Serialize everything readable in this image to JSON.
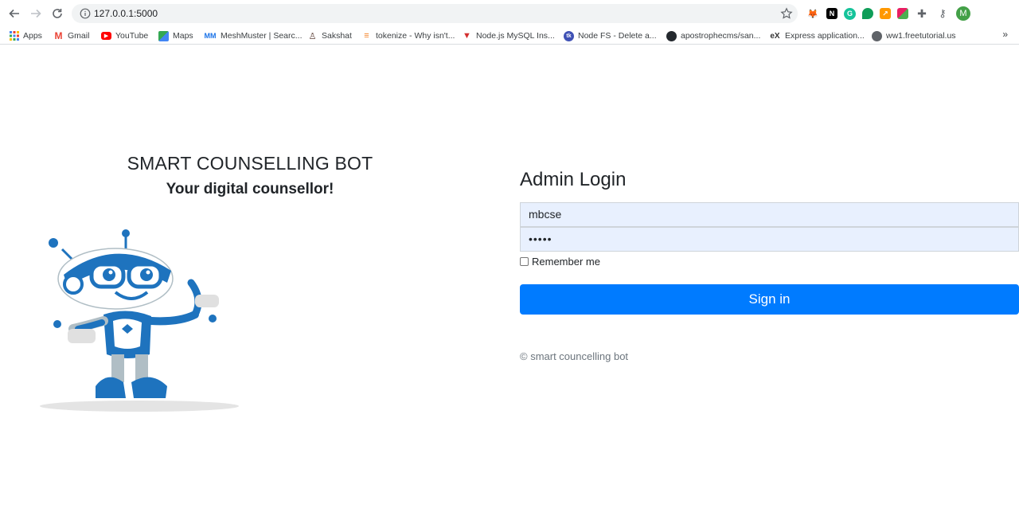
{
  "browser": {
    "url": "127.0.0.1:5000",
    "profile_initial": "M",
    "bookmarks": [
      {
        "label": "Apps",
        "icon": "apps-grid-icon"
      },
      {
        "label": "Gmail",
        "icon": "gmail-icon"
      },
      {
        "label": "YouTube",
        "icon": "youtube-icon"
      },
      {
        "label": "Maps",
        "icon": "maps-icon"
      },
      {
        "label": "MeshMuster | Searc...",
        "icon": "meshmuster-icon"
      },
      {
        "label": "Sakshat",
        "icon": "sakshat-icon"
      },
      {
        "label": "tokenize - Why isn't...",
        "icon": "tokenize-icon"
      },
      {
        "label": "Node.js MySQL Ins...",
        "icon": "node-mysql-icon"
      },
      {
        "label": "Node FS - Delete a...",
        "icon": "node-fs-icon"
      },
      {
        "label": "apostrophecms/san...",
        "icon": "github-icon"
      },
      {
        "label": "Express application...",
        "icon": "express-icon"
      },
      {
        "label": "ww1.freetutorial.us",
        "icon": "globe-icon"
      }
    ],
    "more": "»"
  },
  "brand": {
    "title": "SMART COUNSELLING BOT",
    "subtitle": "Your digital counsellor!"
  },
  "login": {
    "title": "Admin Login",
    "username_value": "mbcse",
    "password_value": "•••••",
    "remember_label": "Remember me",
    "signin_label": "Sign in",
    "footer": "© smart councelling bot"
  },
  "colors": {
    "primary": "#007bff",
    "autofill_bg": "#e8f0fe",
    "robot_blue": "#1e73be"
  }
}
